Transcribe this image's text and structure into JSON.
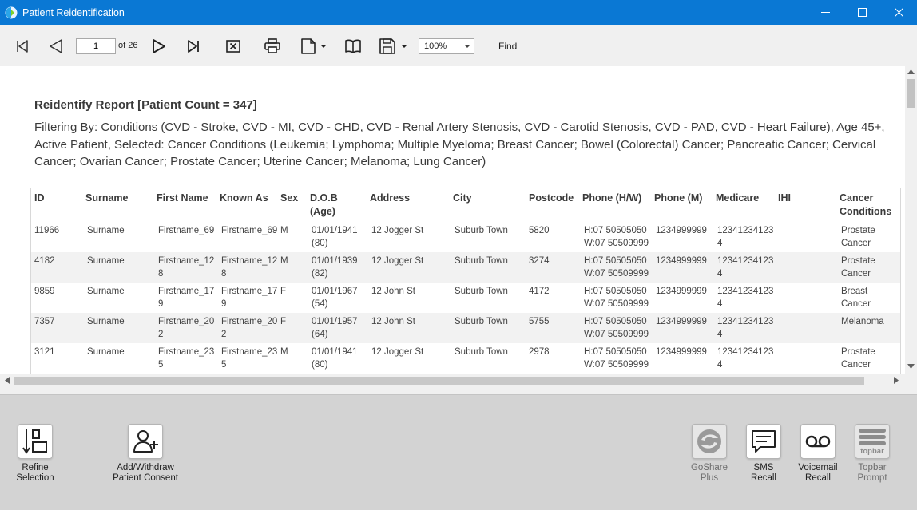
{
  "window": {
    "title": "Patient Reidentification"
  },
  "toolbar": {
    "page_value": "1",
    "of_label": "of 26",
    "zoom": "100%",
    "find_label": "Find"
  },
  "report": {
    "title": "Reidentify Report  [Patient Count = 347]",
    "filter": "Filtering By: Conditions (CVD - Stroke, CVD - MI, CVD - CHD, CVD - Renal Artery Stenosis, CVD - Carotid Stenosis, CVD - PAD, CVD - Heart Failure), Age 45+, Active Patient, Selected: Cancer Conditions (Leukemia; Lymphoma; Multiple Myeloma; Breast Cancer; Bowel (Colorectal) Cancer; Pancreatic Cancer; Cervical Cancer; Ovarian Cancer; Prostate Cancer; Uterine Cancer; Melanoma; Lung Cancer)"
  },
  "table": {
    "headers": [
      "ID",
      "Surname",
      "First Name",
      "Known As",
      "Sex",
      "D.O.B\n(Age)",
      "Address",
      "City",
      "Postcode",
      "Phone (H/W)",
      "Phone (M)",
      "Medicare",
      "IHI",
      "Cancer\nConditions"
    ],
    "rows": [
      [
        "11966",
        "Surname",
        "Firstname_69",
        "Firstname_69",
        "M",
        "01/01/1941\n(80)",
        "12 Jogger St",
        "Suburb Town",
        "5820",
        "H:07 50505050\nW:07 50509999",
        "1234999999",
        "12341234123\n4",
        "",
        "Prostate\nCancer"
      ],
      [
        "4182",
        "Surname",
        "Firstname_12\n8",
        "Firstname_12\n8",
        "M",
        "01/01/1939\n(82)",
        "12 Jogger St",
        "Suburb Town",
        "3274",
        "H:07 50505050\nW:07 50509999",
        "1234999999",
        "12341234123\n4",
        "",
        "Prostate\nCancer"
      ],
      [
        "9859",
        "Surname",
        "Firstname_17\n9",
        "Firstname_17\n9",
        "F",
        "01/01/1967\n(54)",
        "12 John St",
        "Suburb Town",
        "4172",
        "H:07 50505050\nW:07 50509999",
        "1234999999",
        "12341234123\n4",
        "",
        "Breast\nCancer"
      ],
      [
        "7357",
        "Surname",
        "Firstname_20\n2",
        "Firstname_20\n2",
        "F",
        "01/01/1957\n(64)",
        "12 John St",
        "Suburb Town",
        "5755",
        "H:07 50505050\nW:07 50509999",
        "1234999999",
        "12341234123\n4",
        "",
        "Melanoma"
      ],
      [
        "3121",
        "Surname",
        "Firstname_23\n5",
        "Firstname_23\n5",
        "M",
        "01/01/1941\n(80)",
        "12 Jogger St",
        "Suburb Town",
        "2978",
        "H:07 50505050\nW:07 50509999",
        "1234999999",
        "12341234123\n4",
        "",
        "Prostate\nCancer"
      ]
    ]
  },
  "actions": {
    "refine": "Refine\nSelection",
    "consent": "Add/Withdraw\nPatient Consent",
    "goshare": "GoShare\nPlus",
    "sms": "SMS\nRecall",
    "voicemail": "Voicemail\nRecall",
    "topbar": "Topbar\nPrompt",
    "topbar_logo": "topbar"
  }
}
